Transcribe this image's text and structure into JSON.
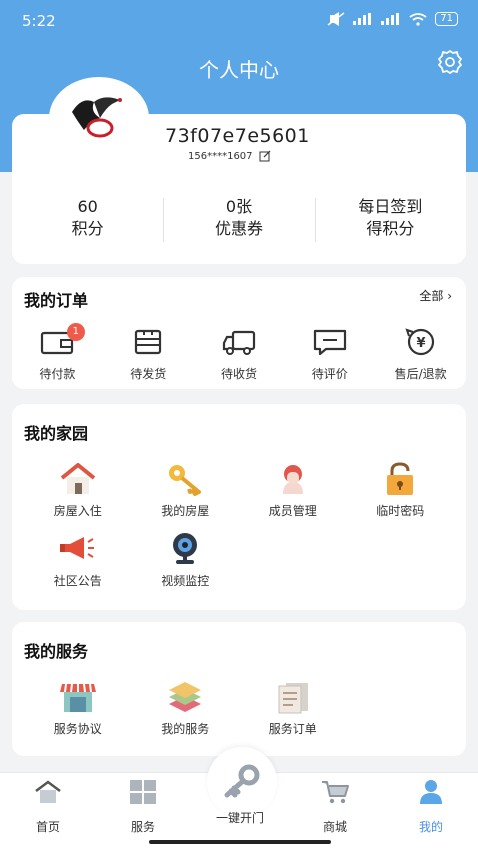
{
  "status": {
    "time": "5:22",
    "battery": "71"
  },
  "header": {
    "title": "个人中心"
  },
  "profile": {
    "username": "73f07e7e5601",
    "phone": "156****1607"
  },
  "stats": [
    {
      "value": "60",
      "label": "积分"
    },
    {
      "value": "0张",
      "label": "优惠券"
    },
    {
      "value": "每日签到",
      "label": "得积分"
    }
  ],
  "orders": {
    "title": "我的订单",
    "all_label": "全部",
    "items": [
      {
        "label": "待付款",
        "badge": "1",
        "icon": "wallet-icon"
      },
      {
        "label": "待发货",
        "icon": "package-icon"
      },
      {
        "label": "待收货",
        "icon": "truck-icon"
      },
      {
        "label": "待评价",
        "icon": "comment-icon"
      },
      {
        "label": "售后/退款",
        "icon": "refund-icon"
      }
    ]
  },
  "home": {
    "title": "我的家园",
    "items": [
      {
        "label": "房屋入住",
        "icon": "house-icon"
      },
      {
        "label": "我的房屋",
        "icon": "key-icon"
      },
      {
        "label": "成员管理",
        "icon": "member-icon"
      },
      {
        "label": "临时密码",
        "icon": "lock-icon"
      },
      {
        "label": "社区公告",
        "icon": "megaphone-icon"
      },
      {
        "label": "视频监控",
        "icon": "camera-icon"
      }
    ]
  },
  "services": {
    "title": "我的服务",
    "items": [
      {
        "label": "服务协议",
        "icon": "shop-icon"
      },
      {
        "label": "我的服务",
        "icon": "layers-icon"
      },
      {
        "label": "服务订单",
        "icon": "document-icon"
      }
    ]
  },
  "tabbar": {
    "items": [
      {
        "label": "首页",
        "icon": "home-icon"
      },
      {
        "label": "服务",
        "icon": "grid-icon"
      },
      {
        "label": "一键开门",
        "icon": "key-icon"
      },
      {
        "label": "商城",
        "icon": "cart-icon"
      },
      {
        "label": "我的",
        "icon": "user-icon"
      }
    ],
    "active_color": "#4a90e2"
  },
  "colors": {
    "header": "#5aa6e6",
    "badge": "#f05a4a"
  }
}
